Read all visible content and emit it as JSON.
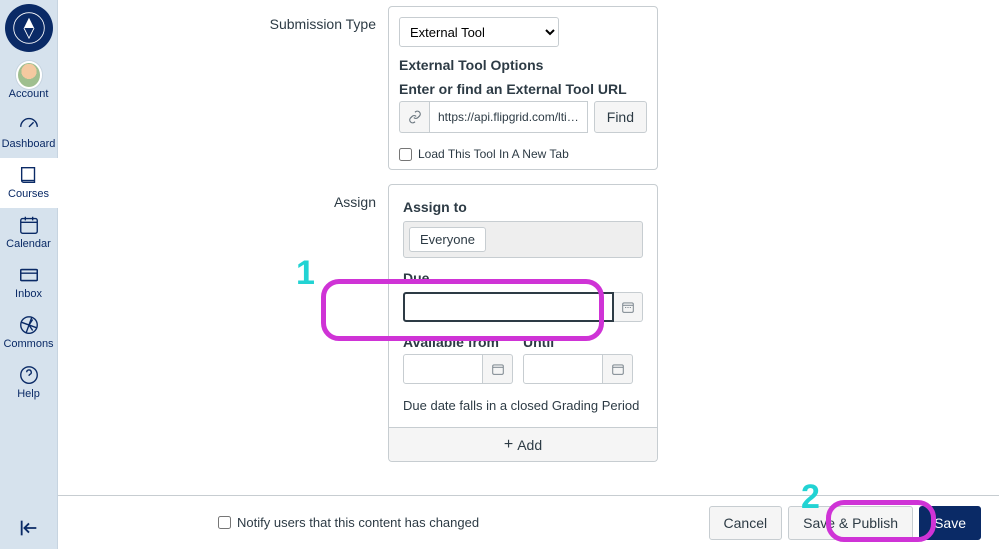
{
  "sidebar": {
    "items": [
      {
        "label": "Account"
      },
      {
        "label": "Dashboard"
      },
      {
        "label": "Courses"
      },
      {
        "label": "Calendar"
      },
      {
        "label": "Inbox"
      },
      {
        "label": "Commons"
      },
      {
        "label": "Help"
      }
    ]
  },
  "form": {
    "submission_type_label": "Submission Type",
    "submission_type_value": "External Tool",
    "external_tool_heading": "External Tool Options",
    "external_tool_url_label": "Enter or find an External Tool URL",
    "external_tool_url_value": "https://api.flipgrid.com/lti/canvas_launch",
    "find_label": "Find",
    "new_tab_label": "Load This Tool In A New Tab",
    "assign_label": "Assign",
    "assign_to_label": "Assign to",
    "assign_to_token": "Everyone",
    "due_label": "Due",
    "due_value": "",
    "available_from_label": "Available from",
    "available_from_value": "",
    "until_label": "Until",
    "until_value": "",
    "grading_warning": "Due date falls in a closed Grading Period",
    "add_label": "Add"
  },
  "footer": {
    "notify_label": "Notify users that this content has changed",
    "cancel_label": "Cancel",
    "save_publish_label": "Save & Publish",
    "save_label": "Save"
  },
  "annotations": {
    "num1": "1",
    "num2": "2"
  }
}
